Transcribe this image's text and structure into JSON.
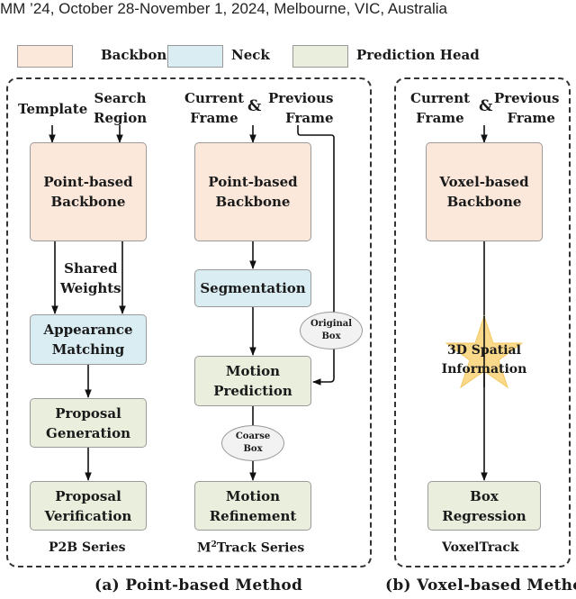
{
  "header": {
    "text": "MM ’24, October 28-November 1, 2024, Melbourne, VIC, Australia"
  },
  "legend": [
    {
      "label": "Backbone",
      "color": "#fbe8db"
    },
    {
      "label": "Neck",
      "color": "#daedf3"
    },
    {
      "label": "Prediction Head",
      "color": "#e9eedd"
    }
  ],
  "panel_a": {
    "caption": "(a) Point-based Method",
    "p2b": {
      "input_left": "Template",
      "input_right_line1": "Search",
      "input_right_line2": "Region",
      "backbone_line1": "Point-based",
      "backbone_line2": "Backbone",
      "shared_line1": "Shared",
      "shared_line2": "Weights",
      "neck_line1": "Appearance",
      "neck_line2": "Matching",
      "head1_line1": "Proposal",
      "head1_line2": "Generation",
      "head2_line1": "Proposal",
      "head2_line2": "Verification",
      "series": "P2B Series"
    },
    "m2track": {
      "input_left_line1": "Current",
      "input_left_line2": "Frame",
      "amp": "&",
      "input_right_line1": "Previous",
      "input_right_line2": "Frame",
      "backbone_line1": "Point-based",
      "backbone_line2": "Backbone",
      "neck": "Segmentation",
      "original_box_line1": "Original",
      "original_box_line2": "Box",
      "head1_line1": "Motion",
      "head1_line2": "Prediction",
      "coarse_box_line1": "Coarse",
      "coarse_box_line2": "Box",
      "head2_line1": "Motion",
      "head2_line2": "Refinement",
      "series_prefix": "M",
      "series_sup": "2",
      "series_suffix": "Track Series"
    }
  },
  "panel_b": {
    "caption": "(b) Voxel-based Method",
    "input_left_line1": "Current",
    "input_left_line2": "Frame",
    "amp": "&",
    "input_right_line1": "Previous",
    "input_right_line2": "Frame",
    "backbone_line1": "Voxel-based",
    "backbone_line2": "Backbone",
    "star_line1": "3D Spatial",
    "star_line2": "Information",
    "star_color": "#fbd98a",
    "head_line1": "Box",
    "head_line2": "Regression",
    "series": "VoxelTrack"
  }
}
